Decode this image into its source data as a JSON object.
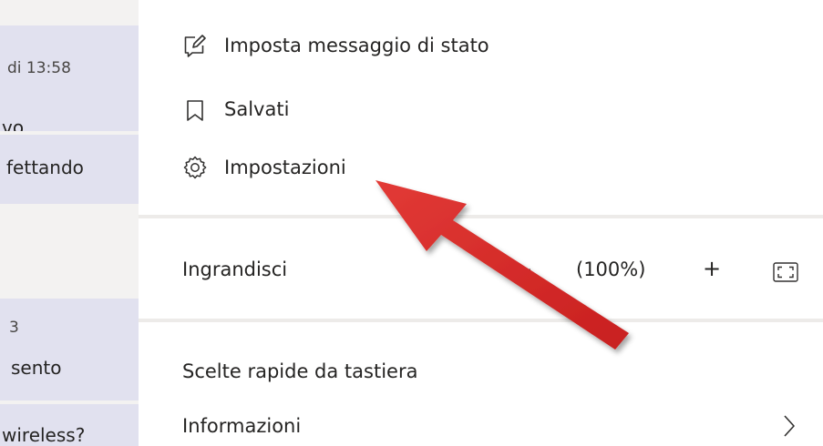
{
  "chat_list": {
    "items": [
      {
        "line1": "di 13:58",
        "line2": "vo"
      },
      {
        "line1": "fettando"
      },
      {
        "line1": "3",
        "line2": "sento"
      },
      {
        "line1": "wireless?"
      }
    ]
  },
  "menu": {
    "set_status_label": "Imposta messaggio di stato",
    "saved_label": "Salvati",
    "settings_label": "Impostazioni",
    "zoom": {
      "label": "Ingrandisci",
      "minus": "—",
      "value": "(100%)",
      "plus": "+"
    },
    "shortcuts_label": "Scelte rapide da tastiera",
    "about_label": "Informazioni"
  },
  "icons": {
    "set_status": "edit-status-icon",
    "saved": "bookmark-icon",
    "settings": "gear-icon",
    "fullscreen": "fullscreen-icon",
    "about": "chevron-right-icon"
  },
  "colors": {
    "annotation_arrow": "#d92b2b",
    "chat_item_bg": "#e1e1ef",
    "divider": "#edebe9"
  }
}
